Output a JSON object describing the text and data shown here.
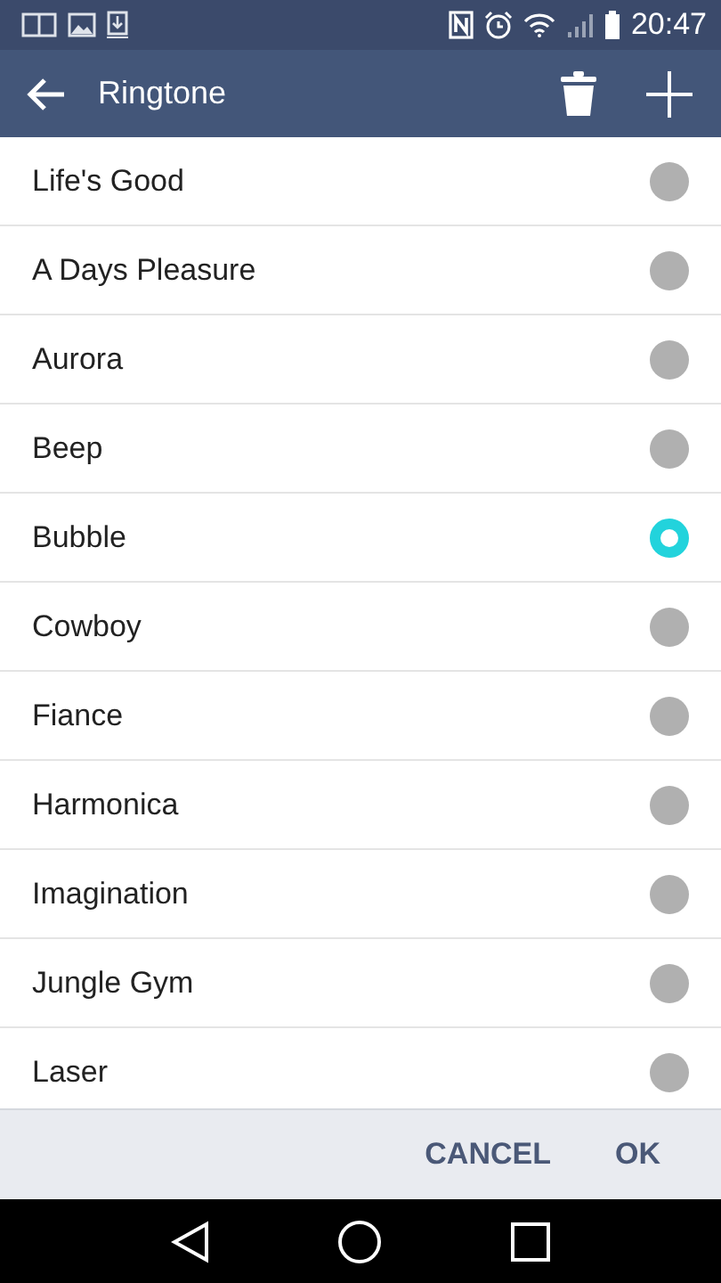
{
  "status_bar": {
    "time": "20:47"
  },
  "app_bar": {
    "title": "Ringtone"
  },
  "ringtones": [
    {
      "name": "Life's Good",
      "selected": false
    },
    {
      "name": "A Days Pleasure",
      "selected": false
    },
    {
      "name": "Aurora",
      "selected": false
    },
    {
      "name": "Beep",
      "selected": false
    },
    {
      "name": "Bubble",
      "selected": true
    },
    {
      "name": "Cowboy",
      "selected": false
    },
    {
      "name": "Fiance",
      "selected": false
    },
    {
      "name": "Harmonica",
      "selected": false
    },
    {
      "name": "Imagination",
      "selected": false
    },
    {
      "name": "Jungle Gym",
      "selected": false
    },
    {
      "name": "Laser",
      "selected": false
    }
  ],
  "buttons": [
    "CANCEL",
    "OK"
  ]
}
